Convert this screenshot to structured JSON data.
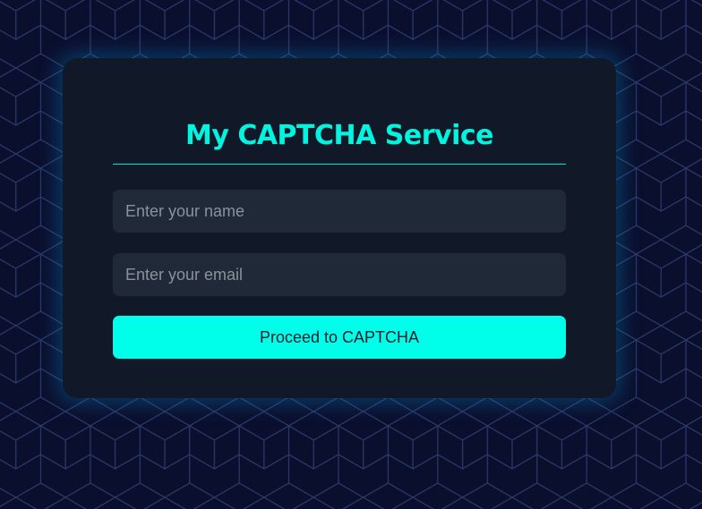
{
  "colors": {
    "background": "#0b0f2e",
    "grid_lines": "#2c3a6a",
    "card": "#111827",
    "accent": "#00f5e0",
    "input_bg": "#1f2937",
    "button_bg": "#00ffea",
    "button_text": "#1a1d2b"
  },
  "form": {
    "title": "My CAPTCHA Service",
    "name_placeholder": "Enter your name",
    "email_placeholder": "Enter your email",
    "name_value": "",
    "email_value": "",
    "submit_label": "Proceed to CAPTCHA"
  }
}
